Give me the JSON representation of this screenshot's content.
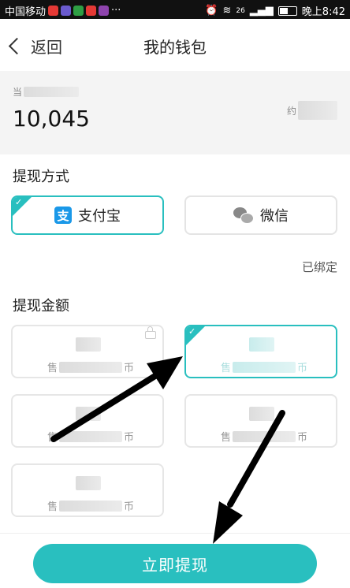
{
  "status_bar": {
    "carrier": "中国移动",
    "network": "26",
    "time": "晚上8:42",
    "app_icon_colors": [
      "#e53935",
      "#6a5acd",
      "#2e9e44",
      "#e53935",
      "#8e44ad"
    ]
  },
  "nav": {
    "back_label": "返回",
    "title": "我的钱包"
  },
  "balance": {
    "label_prefix": "当",
    "amount": "10,045",
    "approx_prefix": "约"
  },
  "withdraw_method": {
    "title": "提现方式",
    "options": [
      {
        "label": "支付宝",
        "logo_text": "支",
        "selected": true
      },
      {
        "label": "微信",
        "selected": false
      }
    ],
    "bound_label": "已绑定"
  },
  "withdraw_amount": {
    "title": "提现金额",
    "options": [
      {
        "price_prefix": "售",
        "price_suffix": "币",
        "selected": false,
        "locked": true
      },
      {
        "price_prefix": "售",
        "price_suffix": "币",
        "selected": true,
        "locked": false
      },
      {
        "price_prefix": "售",
        "price_suffix": "币",
        "selected": false,
        "locked": false
      },
      {
        "price_prefix": "售",
        "price_suffix": "币",
        "selected": false,
        "locked": false
      },
      {
        "price_prefix": "售",
        "price_suffix": "币",
        "selected": false,
        "locked": false
      }
    ]
  },
  "submit_label": "立即提现",
  "colors": {
    "accent": "#29bfbf",
    "alipay": "#1a98e8"
  }
}
